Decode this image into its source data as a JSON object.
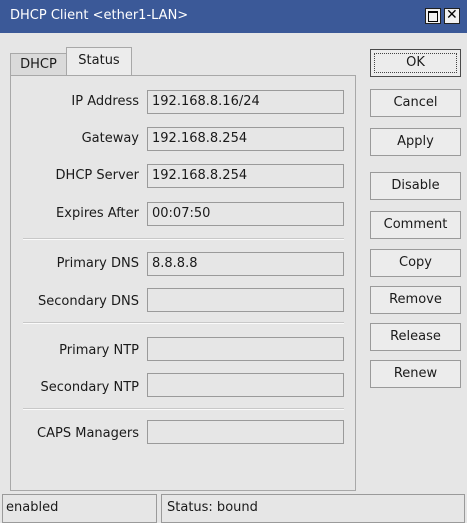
{
  "window": {
    "title": "DHCP Client <ether1-LAN>"
  },
  "tabs": [
    {
      "label": "DHCP",
      "active": false
    },
    {
      "label": "Status",
      "active": true
    }
  ],
  "status_tab": {
    "fields": [
      {
        "label": "IP Address",
        "value": "192.168.8.16/24"
      },
      {
        "label": "Gateway",
        "value": "192.168.8.254"
      },
      {
        "label": "DHCP Server",
        "value": "192.168.8.254"
      },
      {
        "label": "Expires After",
        "value": "00:07:50"
      },
      {
        "label": "Primary DNS",
        "value": "8.8.8.8"
      },
      {
        "label": "Secondary DNS",
        "value": ""
      },
      {
        "label": "Primary NTP",
        "value": ""
      },
      {
        "label": "Secondary NTP",
        "value": ""
      },
      {
        "label": "CAPS Managers",
        "value": ""
      }
    ]
  },
  "buttons": {
    "ok": "OK",
    "cancel": "Cancel",
    "apply": "Apply",
    "disable": "Disable",
    "comment": "Comment",
    "copy": "Copy",
    "remove": "Remove",
    "release": "Release",
    "renew": "Renew"
  },
  "statusbar": {
    "enabled": "enabled",
    "status": "Status: bound"
  },
  "colors": {
    "titlebar": "#3b5998",
    "background": "#e6e6e6"
  },
  "icons": {
    "maximize": "maximize-icon",
    "close": "close-icon"
  }
}
